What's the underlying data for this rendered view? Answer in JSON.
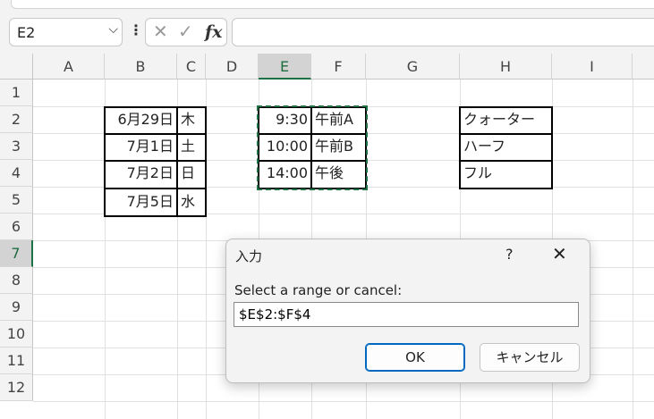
{
  "name_box": {
    "value": "E2"
  },
  "formula_bar": {
    "value": ""
  },
  "columns": [
    "A",
    "B",
    "C",
    "D",
    "E",
    "F",
    "G",
    "H",
    "I"
  ],
  "rows": [
    "1",
    "2",
    "3",
    "4",
    "5",
    "6",
    "7",
    "8",
    "9",
    "10",
    "11",
    "12"
  ],
  "selected_column": "E",
  "selected_row": "7",
  "cells": {
    "B2": "6月29日",
    "C2": "木",
    "B3": "7月1日",
    "C3": "土",
    "B4": "7月2日",
    "C4": "日",
    "B5": "7月5日",
    "C5": "水",
    "E2": "9:30",
    "F2": "午前A",
    "E3": "10:00",
    "F3": "午前B",
    "E4": "14:00",
    "F4": "午後",
    "H2": "クォーター",
    "H3": "ハーフ",
    "H4": "フル"
  },
  "dialog": {
    "title": "入力",
    "help": "?",
    "close": "✕",
    "prompt": "Select a range or cancel:",
    "input_value": "$E$2:$F$4",
    "ok_label": "OK",
    "cancel_label": "キャンセル"
  },
  "colors": {
    "selection_green": "#1e7145",
    "ok_border": "#0067c0"
  },
  "icons": {
    "namebox_dropdown": "chevron-down-icon",
    "cancel_entry": "x-icon",
    "confirm_entry": "checkmark-icon",
    "insert_function": "fx-icon"
  }
}
